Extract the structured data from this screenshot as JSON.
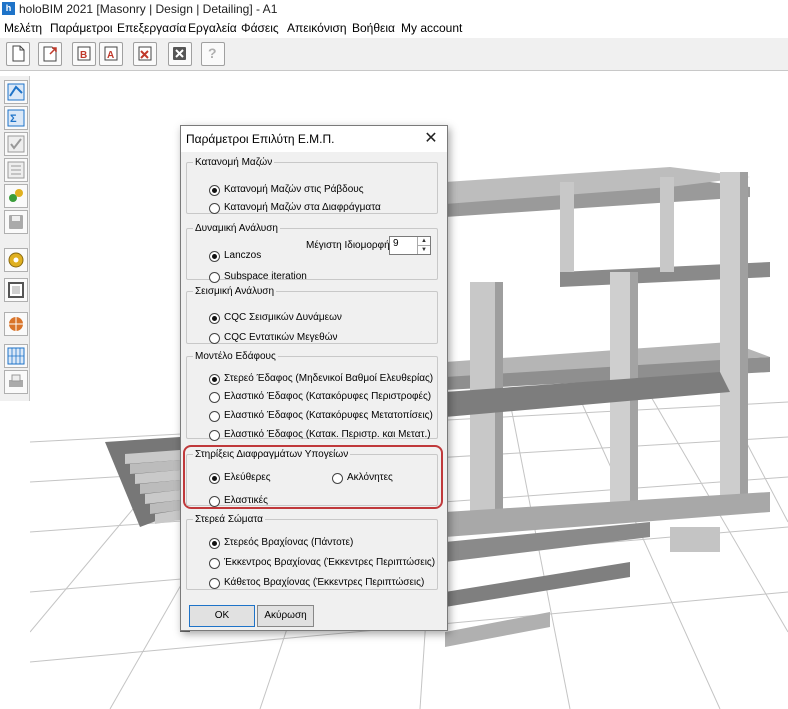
{
  "window": {
    "app_icon_letter": "h",
    "title": "holoBIM 2021 [Masonry | Design | Detailing] - A1"
  },
  "menubar": {
    "items": [
      "Μελέτη",
      "Παράμετροι",
      "Επεξεργασία",
      "Εργαλεία",
      "Φάσεις",
      "Απεικόνιση",
      "Βοήθεια",
      "My account"
    ]
  },
  "toolbar": {
    "buttons": [
      "new-file-icon",
      "open-file-icon",
      "b-print-icon",
      "a-print-icon",
      "close-file-icon",
      "delete-icon",
      "help-icon"
    ],
    "help_label": "?"
  },
  "sidebar": {
    "buttons": [
      "design-icon",
      "calc-icon",
      "check-icon",
      "list-icon",
      "nodes-icon",
      "save-icon",
      "tape-icon",
      "frame-icon",
      "globe-icon",
      "plan-icon",
      "print-icon"
    ]
  },
  "dialog": {
    "title": "Παράμετροι Επιλύτη Ε.Μ.Π.",
    "close_glyph": "✕",
    "groups": {
      "mass": {
        "legend": "Κατανομή Μαζών",
        "options": [
          "Κατανομή Μαζών στις Ράβδους",
          "Κατανομή Μαζών στα Διαφράγματα"
        ],
        "selected": 0
      },
      "dynamic": {
        "legend": "Δυναμική Ανάλυση",
        "options": [
          "Lanczos",
          "Subspace iteration"
        ],
        "selected": 0,
        "max_mode_label": "Μέγιστη Ιδιομορφή",
        "max_mode_value": "9",
        "spin_up": "▲",
        "spin_down": "▼"
      },
      "seismic": {
        "legend": "Σεισμική Ανάλυση",
        "options": [
          "CQC Σεισμικών Δυνάμεων",
          "CQC Εντατικών Μεγεθών"
        ],
        "selected": 0
      },
      "soil": {
        "legend": "Μοντέλο Εδάφους",
        "options": [
          "Στερεό Έδαφος (Μηδενικοί Βαθμοί Ελευθερίας)",
          "Ελαστικό Έδαφος (Κατακόρυφες Περιστροφές)",
          "Ελαστικό Έδαφος (Κατακόρυφες Μετατοπίσεις)",
          "Ελαστικό Έδαφος (Κατακ. Περιστρ. και  Μετατ.)"
        ],
        "selected": 0
      },
      "supports": {
        "legend": "Στηρίξεις Διαφραγμάτων Υπογείων",
        "options": [
          "Ελεύθερες",
          "Ακλόνητες",
          "Ελαστικές"
        ],
        "selected": 0
      },
      "rigid": {
        "legend": "Στερεά Σώματα",
        "options": [
          "Στερεός Βραχίονας (Πάντοτε)",
          "Έκκεντρος Βραχίονας (Έκκεντρες Περιπτώσεις)",
          "Κάθετος Βραχίονας (Έκκεντρες Περιπτώσεις)"
        ],
        "selected": 0
      }
    },
    "ok_label": "OK",
    "cancel_label": "Ακύρωση"
  },
  "colors": {
    "highlight": "#c0393b",
    "accent": "#1e73c8"
  }
}
